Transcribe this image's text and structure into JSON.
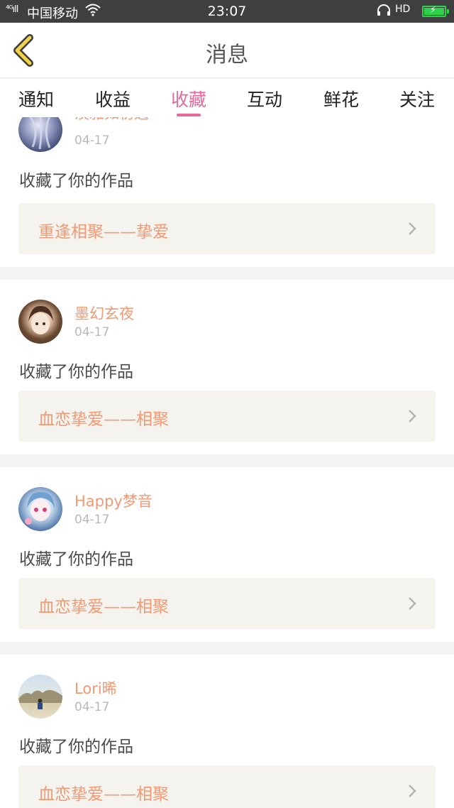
{
  "status_bar": {
    "signal": "⁴ᴳıll",
    "carrier": "中国移动",
    "time": "23:07",
    "hd": "HD",
    "colors": {
      "battery": "#2ed14c",
      "background": "#3f3f3f"
    }
  },
  "header": {
    "title": "消息",
    "back_icon": "chevron-left-icon",
    "accent": "#f2d24a"
  },
  "tabs": [
    {
      "label": "通知",
      "active": false
    },
    {
      "label": "收益",
      "active": false
    },
    {
      "label": "收藏",
      "active": true
    },
    {
      "label": "互动",
      "active": false
    },
    {
      "label": "鲜花",
      "active": false
    },
    {
      "label": "关注",
      "active": false
    }
  ],
  "colors": {
    "active_tab": "#e7699b",
    "username": "#f19a74",
    "work_title": "#f19a74"
  },
  "items": [
    {
      "username": "淡雅如初遇",
      "date": "04-17",
      "message": "收藏了你的作品",
      "work_title": "重逢相聚——挚爱"
    },
    {
      "username": "墨幻玄夜",
      "date": "04-17",
      "message": "收藏了你的作品",
      "work_title": "血恋挚爱——相聚"
    },
    {
      "username": "Happy梦音",
      "date": "04-17",
      "message": "收藏了你的作品",
      "work_title": "血恋挚爱——相聚"
    },
    {
      "username": "Lori晞",
      "date": "04-17",
      "message": "收藏了你的作品",
      "work_title": "血恋挚爱——相聚"
    }
  ]
}
